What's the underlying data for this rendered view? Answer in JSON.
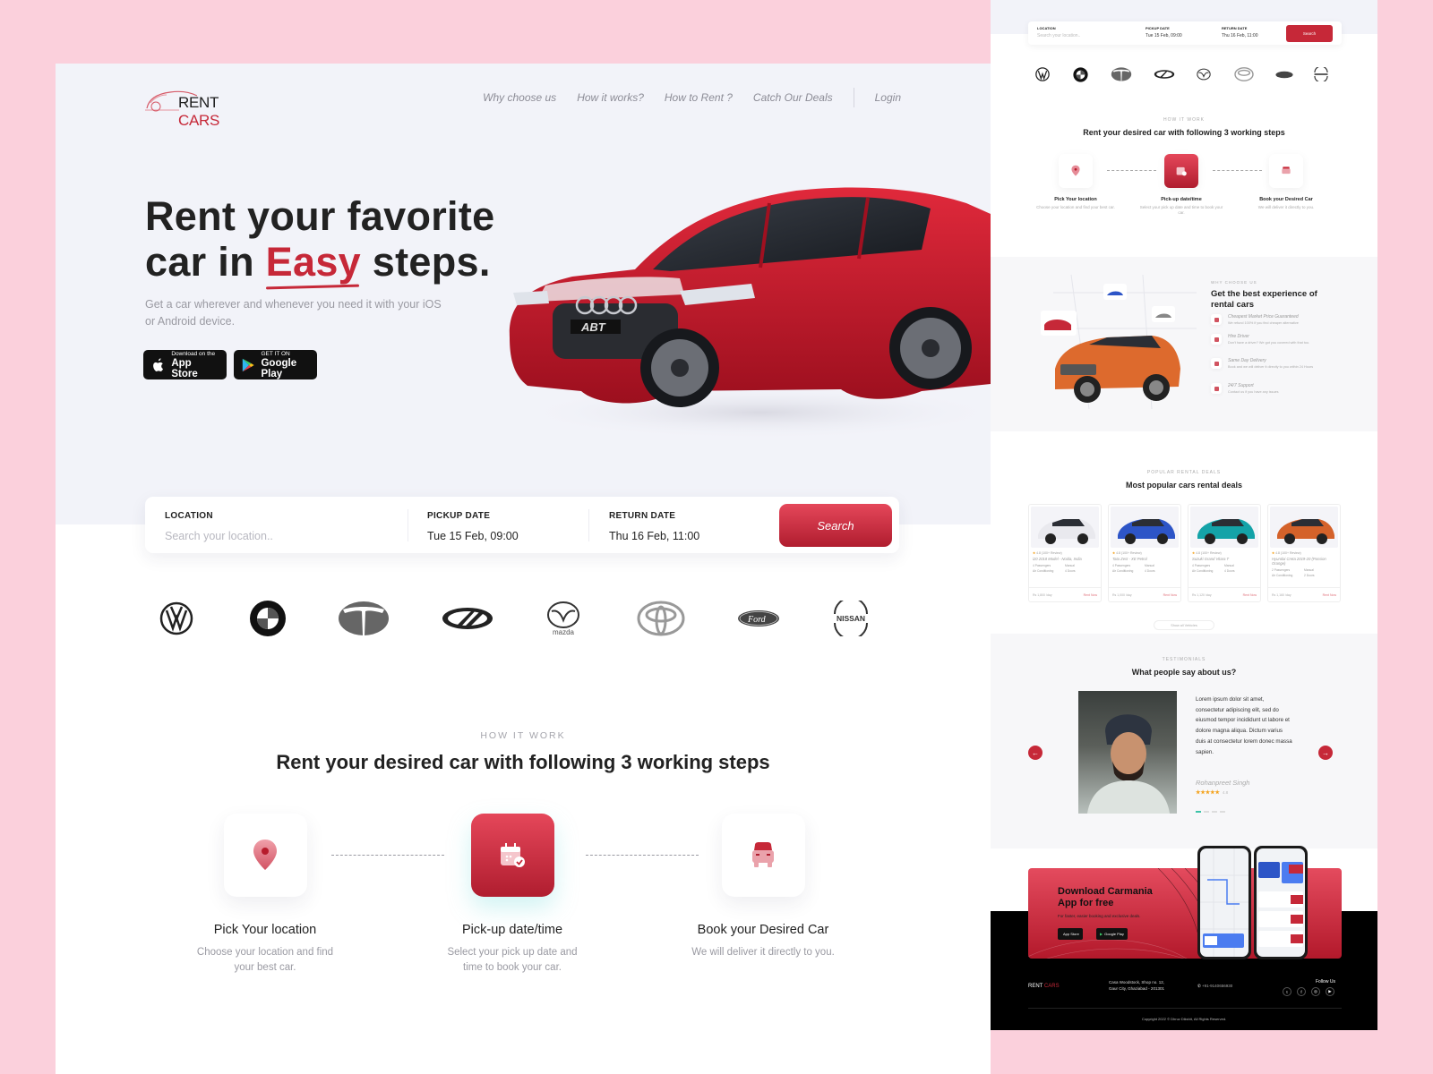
{
  "brand": {
    "name_part1": "RENT",
    "name_part2": "CARS",
    "accent": "#c62838"
  },
  "nav": {
    "items": [
      "Why choose us",
      "How it works?",
      "How to Rent ?",
      "Catch Our Deals"
    ],
    "login": "Login"
  },
  "hero": {
    "line1": "Rent your favorite",
    "line2_pre": "car in ",
    "line2_accent": "Easy",
    "line2_post": " steps.",
    "subtitle": "Get a car wherever and whenever you need it with your iOS or Android device.",
    "appstore_small": "Download on the",
    "appstore_big": "App Store",
    "gplay_small": "GET IT ON",
    "gplay_big": "Google Play"
  },
  "search": {
    "location_label": "LOCATION",
    "location_placeholder": "Search your location..",
    "pickup_label": "PICKUP DATE",
    "pickup_value": "Tue 15 Feb, 09:00",
    "return_label": "RETURN DATE",
    "return_value": "Thu 16 Feb, 11:00",
    "button": "Search"
  },
  "brands": [
    "volkswagen-logo",
    "bmw-logo",
    "tata-logo",
    "mahindra-logo",
    "mazda-logo",
    "toyota-logo",
    "ford-logo",
    "nissan-logo"
  ],
  "brand_text": {
    "mazda": "mazda",
    "ford": "Ford",
    "nissan": "NISSAN"
  },
  "how": {
    "label": "HOW IT WORK",
    "title": "Rent your desired car with following 3 working steps",
    "steps": [
      {
        "title": "Pick Your location",
        "desc": "Choose your location and find your best car.",
        "icon": "location-pin-icon"
      },
      {
        "title": "Pick-up date/time",
        "desc": "Select your pick up date and time to book your car.",
        "icon": "calendar-check-icon"
      },
      {
        "title": "Book your Desired Car",
        "desc": "We will deliver it directly to you.",
        "icon": "car-icon"
      }
    ]
  },
  "why": {
    "label": "WHY CHOOSE US",
    "title": "Get the best experience of rental cars",
    "items": [
      {
        "title": "Cheapest Market Price Guaranteed",
        "desc": "We refund 100% if you find cheaper alternative"
      },
      {
        "title": "Hire Driver",
        "desc": "Don't have a driver? We got you covered with that too."
      },
      {
        "title": "Same Day Delivery",
        "desc": "Book and we will deliver it directly to you within 24 Hours"
      },
      {
        "title": "24/7 Support",
        "desc": "Contact us if you have any issues"
      }
    ]
  },
  "deals": {
    "label": "POPULAR RENTAL DEALS",
    "title": "Most popular cars rental deals",
    "cards": [
      {
        "rating": "4.8",
        "reviews": "(100+ Review)",
        "name": "i20 2018 Model - Noida, India",
        "passengers": "4 Passengers",
        "trans": "Manual",
        "ac": "Air Conditioning",
        "doors": "4 Doors",
        "price": "Rs 1,800 /day",
        "cta": "Rent Now",
        "color": "#e9e9ee"
      },
      {
        "rating": "4.8",
        "reviews": "(100+ Review)",
        "name": "Tata Zest - XE Petrol",
        "passengers": "4 Passengers",
        "trans": "Manual",
        "ac": "Air Conditioning",
        "doors": "4 Doors",
        "price": "Rs 1,000 /day",
        "cta": "Rent Now",
        "color": "#2d55c7"
      },
      {
        "rating": "4.8",
        "reviews": "(100+ Review)",
        "name": "Suzuki Grand Vitara T",
        "passengers": "4 Passengers",
        "trans": "Manual",
        "ac": "Air Conditioning",
        "doors": "4 Doors",
        "price": "Rs 1,120 /day",
        "cta": "Rent Now",
        "color": "#14a3a8"
      },
      {
        "rating": "4.8",
        "reviews": "(100+ Review)",
        "name": "Hyundai Creta 2019-20 (Passion Orange)",
        "passengers": "2 Passengers",
        "trans": "Manual",
        "ac": "Air Conditioning",
        "doors": "2 Doors",
        "price": "Rs 1,160 /day",
        "cta": "Rent Now",
        "color": "#d4622a"
      }
    ],
    "show_all": "Show all Vehicles"
  },
  "testimonial": {
    "label": "TESTIMONIALS",
    "title": "What people say about us?",
    "quote": "Lorem ipsum dolor sit amet, consectetur adipiscing elit, sed do eiusmod tempor incididunt ut labore et dolore magna aliqua. Dictum varius duis at consectetur lorem donec massa sapien.",
    "name": "Rohanpreet Singh",
    "stars": "★★★★★",
    "rating": "4.8"
  },
  "app": {
    "title_line1": "Download Carmania",
    "title_line2": "App for free",
    "subtitle": "For faster, easier booking and exclusive deals.",
    "appstore": "App Store",
    "gplay": "Google Play"
  },
  "footer": {
    "address_line1": "Casa Woodstock, Shop no. 12,",
    "address_line2": "Gaur City, Ghaziabad - 201301",
    "phone": "+91-9140656930",
    "follow": "Follow Us",
    "copyright": "Copyright 2022 © Dhruv Dikshit, All Rights Reserved."
  },
  "side_search": {
    "location_label": "LOCATION",
    "location_placeholder": "Search your location..",
    "pickup_label": "PICKUP DATE",
    "pickup_value": "Tue 15 Feb, 09:00",
    "return_label": "RETURN DATE",
    "return_value": "Thu 16 Feb, 11:00",
    "button": "Search"
  }
}
